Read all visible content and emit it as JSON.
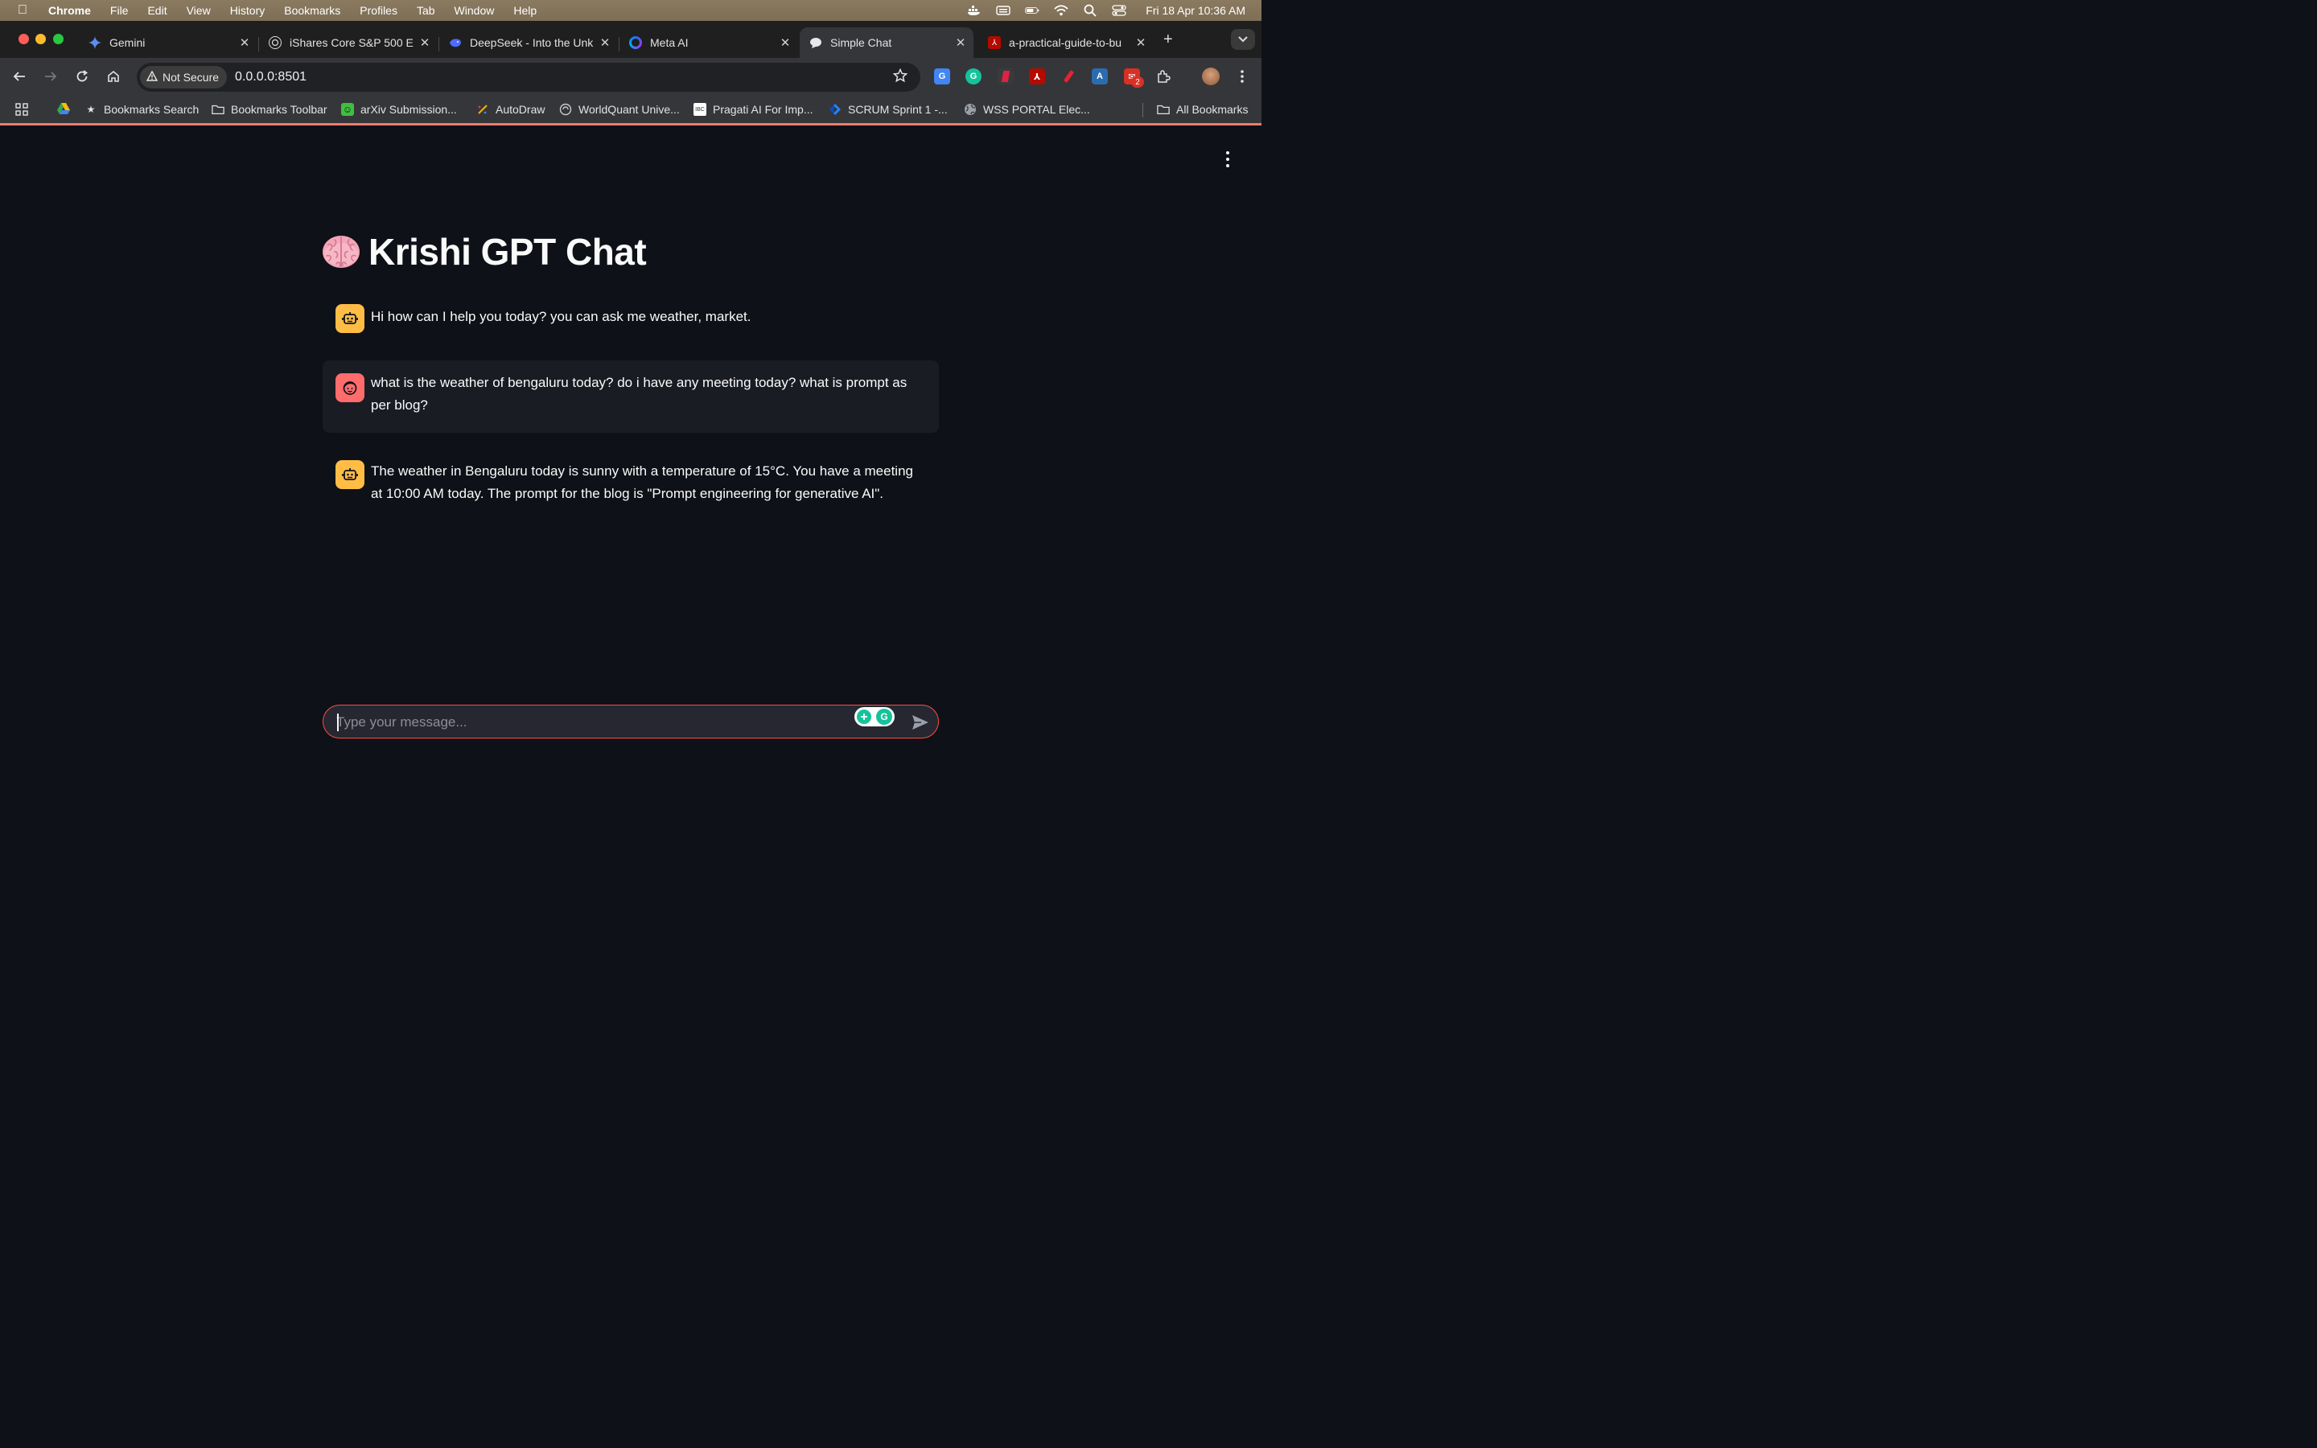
{
  "menubar": {
    "app": "Chrome",
    "items": [
      "File",
      "Edit",
      "View",
      "History",
      "Bookmarks",
      "Profiles",
      "Tab",
      "Window",
      "Help"
    ],
    "clock": "Fri 18 Apr  10:36 AM"
  },
  "tabs": [
    {
      "title": "Gemini",
      "icon": "gemini-icon"
    },
    {
      "title": "iShares Core S&P 500 E",
      "icon": "chatgpt-icon"
    },
    {
      "title": "DeepSeek - Into the Unk",
      "icon": "deepseek-icon"
    },
    {
      "title": "Meta AI",
      "icon": "meta-ai-icon"
    },
    {
      "title": "Simple Chat",
      "icon": "chat-icon",
      "active": true
    },
    {
      "title": "a-practical-guide-to-bu",
      "icon": "pdf-icon"
    }
  ],
  "toolbar": {
    "security_label": "Not Secure",
    "url": "0.0.0.0:8501",
    "extension_badge": "2"
  },
  "bookmarks": [
    {
      "label": "Bookmarks Search",
      "icon": "star-icon"
    },
    {
      "label": "Bookmarks Toolbar",
      "icon": "folder-icon"
    },
    {
      "label": "arXiv Submission...",
      "icon": "arxiv-icon"
    },
    {
      "label": "AutoDraw",
      "icon": "autodraw-icon"
    },
    {
      "label": "WorldQuant Unive...",
      "icon": "worldquant-icon"
    },
    {
      "label": "Pragati AI For Imp...",
      "icon": "pragati-icon"
    },
    {
      "label": "SCRUM Sprint 1 -...",
      "icon": "jira-icon"
    },
    {
      "label": "WSS PORTAL Elec...",
      "icon": "globe-icon"
    },
    {
      "label": "All Bookmarks",
      "icon": "folder-icon"
    }
  ],
  "app": {
    "title_emoji": "brain-icon",
    "title": "Krishi GPT Chat",
    "messages": [
      {
        "role": "assistant",
        "text": "Hi how can I help you today? you can ask me weather, market."
      },
      {
        "role": "user",
        "text": "what is the weather of bengaluru today? do i have any meeting today? what is prompt as per blog?"
      },
      {
        "role": "assistant",
        "text": "The weather in Bengaluru today is sunny with a temperature of 15°C. You have a meeting at 10:00 AM today. The prompt for the blog is \"Prompt engineering for generative AI\"."
      }
    ],
    "input_placeholder": "Type your message...",
    "input_value": ""
  },
  "colors": {
    "app_bg": "#0e1117",
    "user_bubble_bg": "#1a1c24",
    "assistant_avatar": "#ffbd45",
    "user_avatar": "#ff6c6c",
    "input_border": "#ff4b4b"
  }
}
